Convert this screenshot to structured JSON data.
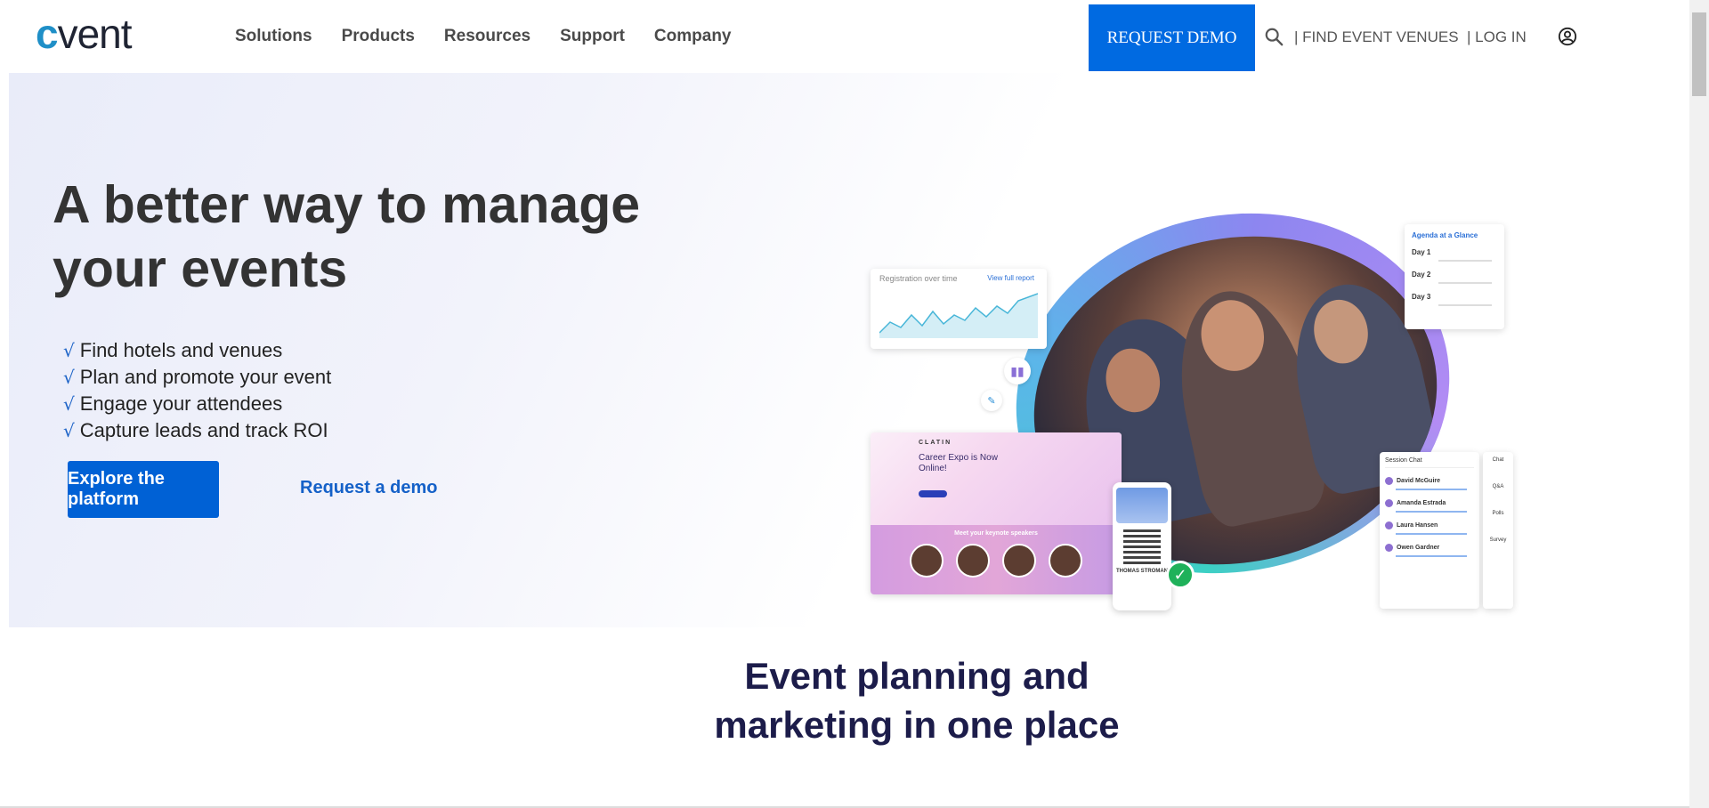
{
  "header": {
    "logo": "cvent",
    "nav": [
      "Solutions",
      "Products",
      "Resources",
      "Support",
      "Company"
    ],
    "demo_button": "REQUEST DEMO",
    "find_venues": "| FIND EVENT VENUES",
    "log_in": "| LOG IN"
  },
  "hero": {
    "title": "A better way to manage your events",
    "checks": [
      "Find hotels and venues",
      "Plan and promote your event",
      "Engage your attendees",
      "Capture leads and track ROI"
    ],
    "tick": "√",
    "explore_button": "Explore the platform",
    "request_link": "Request a demo"
  },
  "illustration": {
    "registration_title": "Registration over time",
    "registration_link": "View full report",
    "agenda_title": "Agenda at a Glance",
    "agenda_days": [
      "Day 1",
      "Day 2",
      "Day 3"
    ],
    "expo_brand": "CLATIN",
    "expo_title": "Career Expo is Now Online!",
    "expo_subtitle": "Meet your keynote speakers",
    "badge_name": "THOMAS STROMAN",
    "check_in": "Check-in Complete",
    "session_chat": "Session Chat",
    "chat_users": [
      "David McGuire",
      "Amanda Estrada",
      "Laura Hansen",
      "Owen Gardner"
    ],
    "side_tools": [
      "Chat",
      "Q&A",
      "Polls",
      "Survey"
    ]
  },
  "section": {
    "title_line1": "Event planning and",
    "title_line2": "marketing in one place"
  },
  "colors": {
    "primary": "#0061d5",
    "heading": "#333333",
    "section_heading": "#1c1c4a"
  }
}
